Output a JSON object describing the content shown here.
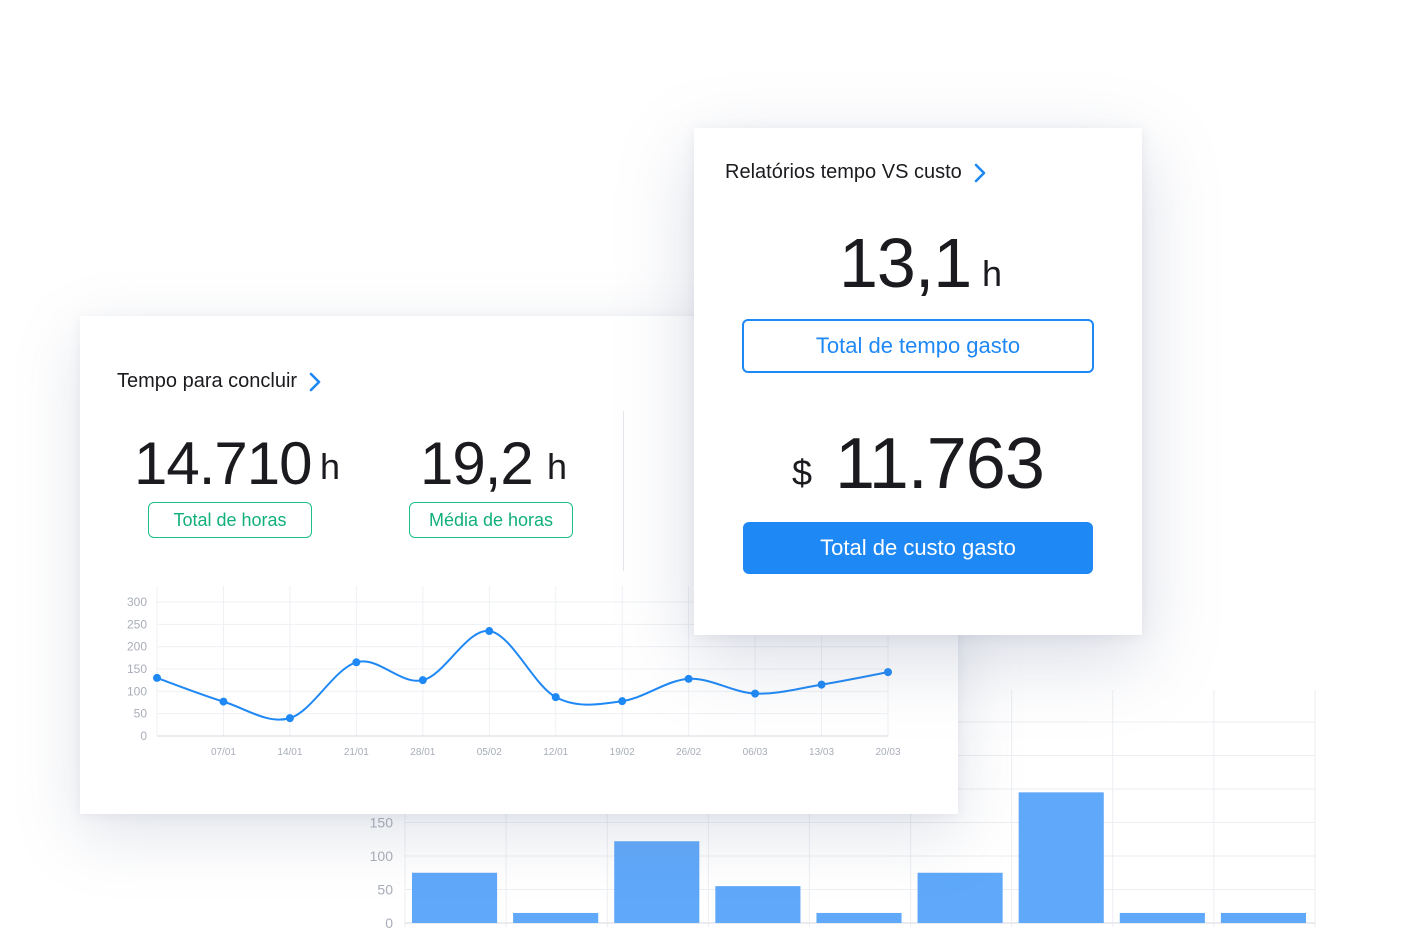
{
  "time_card": {
    "title": "Tempo para concluir",
    "total_hours": {
      "value": "14.710",
      "unit": "h",
      "label": "Total de horas"
    },
    "avg_hours": {
      "value": "19,2",
      "unit": "h",
      "label": "Média de horas"
    }
  },
  "report_card": {
    "title": "Relatórios tempo VS custo",
    "time": {
      "value": "13,1",
      "unit": "h",
      "button": "Total de tempo gasto"
    },
    "cost": {
      "currency": "$",
      "value": "11.763",
      "button": "Total de custo gasto"
    }
  },
  "colors": {
    "accent_blue": "#1e88f5",
    "accent_green": "#1fbf8a",
    "bar_fill": "#5fa8fa"
  },
  "chart_data": [
    {
      "type": "line",
      "x": [
        "",
        "07/01",
        "14/01",
        "21/01",
        "28/01",
        "05/02",
        "12/01",
        "19/02",
        "26/02",
        "06/03",
        "13/03",
        "20/03"
      ],
      "values": [
        130,
        77,
        40,
        165,
        125,
        235,
        87,
        78,
        128,
        95,
        115,
        143
      ],
      "y_ticks": [
        0,
        50,
        100,
        150,
        200,
        250,
        300
      ],
      "ylim": [
        0,
        300
      ],
      "grid": true
    },
    {
      "type": "bar",
      "values": [
        75,
        15,
        122,
        55,
        15,
        75,
        195,
        15,
        15
      ],
      "y_ticks": [
        "0",
        "50",
        "100",
        "150"
      ],
      "ylim": [
        0,
        200
      ],
      "grid": true
    }
  ]
}
